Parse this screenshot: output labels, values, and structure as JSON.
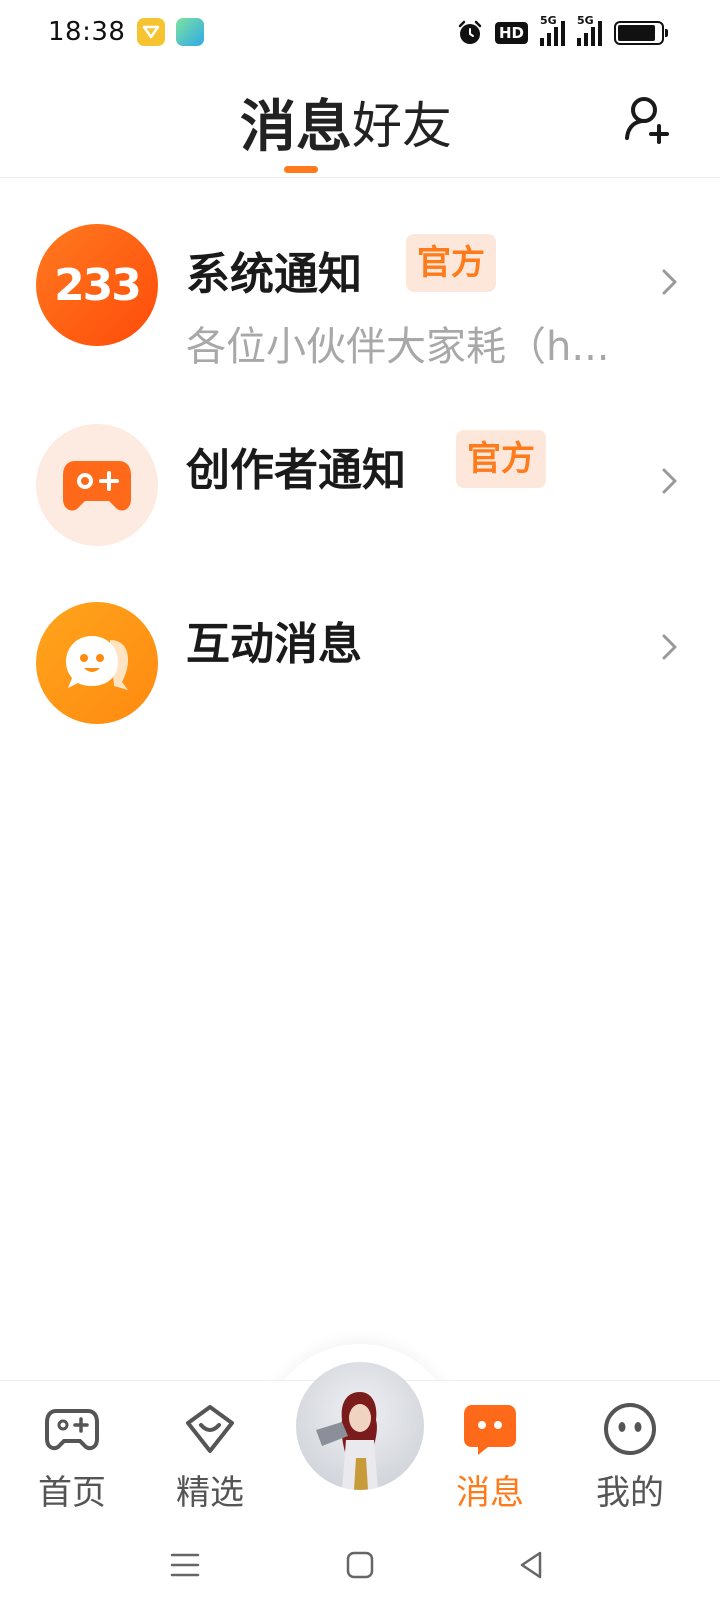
{
  "status_bar": {
    "time": "18:38",
    "hd_label": "HD",
    "network_1": "5G",
    "network_2": "5G"
  },
  "header": {
    "tab_messages": "消息",
    "tab_friends": "好友",
    "accent_color": "#ff7a1a"
  },
  "messages": [
    {
      "avatar_text": "233",
      "title": "系统通知",
      "badge": "官方",
      "preview": "各位小伙伴大家耗（h..."
    },
    {
      "title": "创作者通知",
      "badge": "官方"
    },
    {
      "title": "互动消息"
    }
  ],
  "bottom_nav": {
    "items": [
      {
        "label": "首页",
        "icon": "gamepad-icon"
      },
      {
        "label": "精选",
        "icon": "heart-badge-icon"
      },
      {
        "label": "消息",
        "icon": "chat-bubble-icon",
        "active": true
      },
      {
        "label": "我的",
        "icon": "face-icon"
      }
    ]
  }
}
